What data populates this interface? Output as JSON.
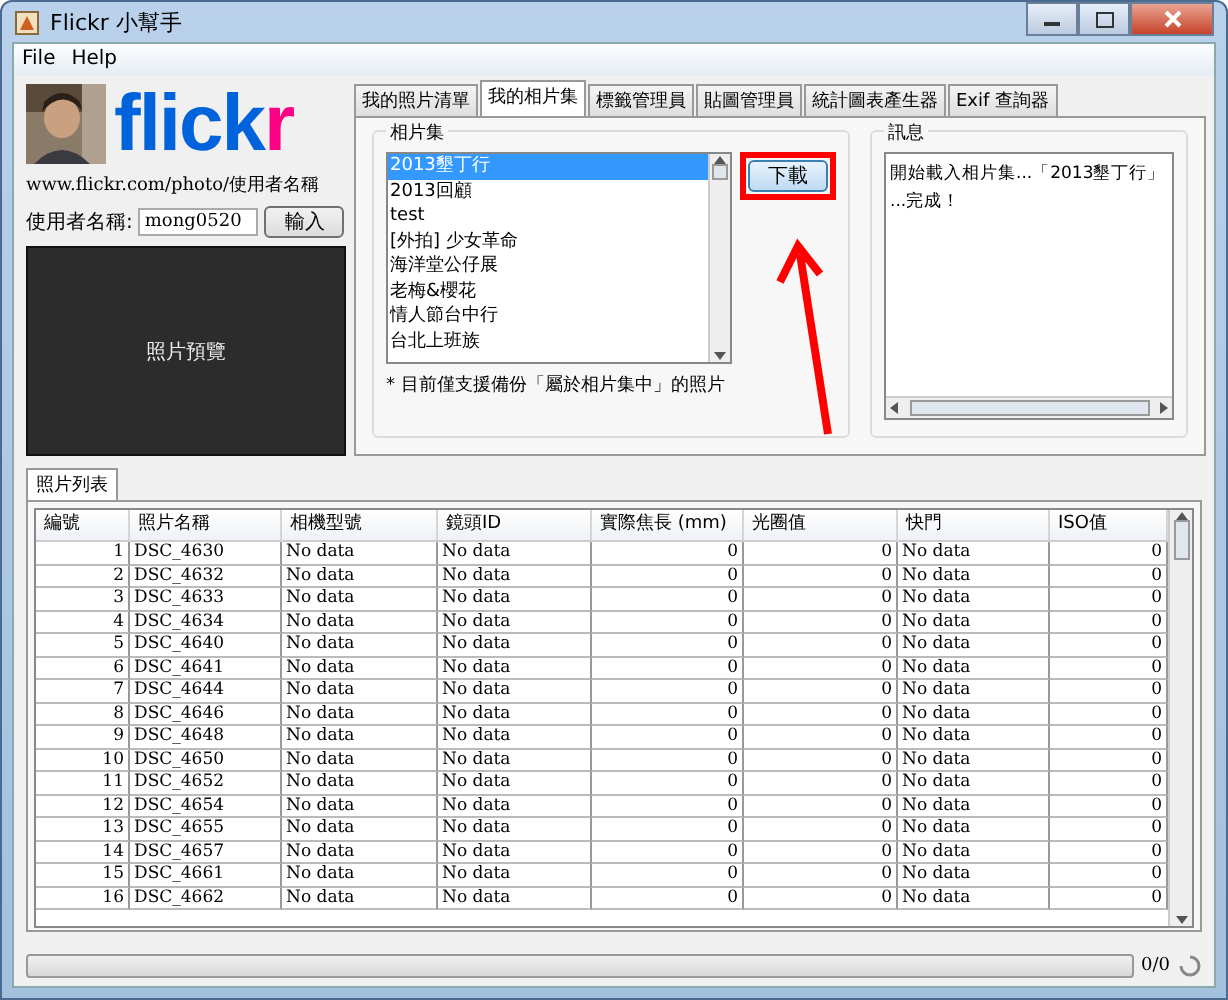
{
  "window": {
    "title": "Flickr 小幫手"
  },
  "menu": [
    "File",
    "Help"
  ],
  "logo": {
    "text": "flickr"
  },
  "profile": {
    "url": "www.flickr.com/photo/使用者名稱",
    "username_label": "使用者名稱:",
    "username": "mong0520",
    "enter_button": "輸入",
    "preview": "照片預覽"
  },
  "tabs": [
    {
      "label": "我的照片清單",
      "selected": false
    },
    {
      "label": "我的相片集",
      "selected": true
    },
    {
      "label": "標籤管理員",
      "selected": false
    },
    {
      "label": "貼圖管理員",
      "selected": false
    },
    {
      "label": "統計圖表產生器",
      "selected": false
    },
    {
      "label": "Exif 查詢器",
      "selected": false
    }
  ],
  "albums": {
    "title": "相片集",
    "items": [
      {
        "label": "2013墾丁行",
        "selected": true
      },
      {
        "label": "2013回顧",
        "selected": false
      },
      {
        "label": "test",
        "selected": false
      },
      {
        "label": "[外拍] 少女革命",
        "selected": false
      },
      {
        "label": "海洋堂公仔展",
        "selected": false
      },
      {
        "label": "老梅&櫻花",
        "selected": false
      },
      {
        "label": "情人節台中行",
        "selected": false
      },
      {
        "label": "台北上班族",
        "selected": false
      }
    ],
    "download_button": "下載",
    "note": "* 目前僅支援備份「屬於相片集中」的照片"
  },
  "messages": {
    "title": "訊息",
    "lines": [
      "開始載入相片集...「2013墾丁行」",
      "...完成！"
    ]
  },
  "photo_tab": {
    "label": "照片列表",
    "selected": true
  },
  "table": {
    "columns": [
      "編號",
      "照片名稱",
      "相機型號",
      "鏡頭ID",
      "實際焦長 (mm)",
      "光圈值",
      "快門",
      "ISO值"
    ],
    "rows": [
      [
        "1",
        "DSC_4630",
        "No data",
        "No data",
        "0",
        "0",
        "No data",
        "0"
      ],
      [
        "2",
        "DSC_4632",
        "No data",
        "No data",
        "0",
        "0",
        "No data",
        "0"
      ],
      [
        "3",
        "DSC_4633",
        "No data",
        "No data",
        "0",
        "0",
        "No data",
        "0"
      ],
      [
        "4",
        "DSC_4634",
        "No data",
        "No data",
        "0",
        "0",
        "No data",
        "0"
      ],
      [
        "5",
        "DSC_4640",
        "No data",
        "No data",
        "0",
        "0",
        "No data",
        "0"
      ],
      [
        "6",
        "DSC_4641",
        "No data",
        "No data",
        "0",
        "0",
        "No data",
        "0"
      ],
      [
        "7",
        "DSC_4644",
        "No data",
        "No data",
        "0",
        "0",
        "No data",
        "0"
      ],
      [
        "8",
        "DSC_4646",
        "No data",
        "No data",
        "0",
        "0",
        "No data",
        "0"
      ],
      [
        "9",
        "DSC_4648",
        "No data",
        "No data",
        "0",
        "0",
        "No data",
        "0"
      ],
      [
        "10",
        "DSC_4650",
        "No data",
        "No data",
        "0",
        "0",
        "No data",
        "0"
      ],
      [
        "11",
        "DSC_4652",
        "No data",
        "No data",
        "0",
        "0",
        "No data",
        "0"
      ],
      [
        "12",
        "DSC_4654",
        "No data",
        "No data",
        "0",
        "0",
        "No data",
        "0"
      ],
      [
        "13",
        "DSC_4655",
        "No data",
        "No data",
        "0",
        "0",
        "No data",
        "0"
      ],
      [
        "14",
        "DSC_4657",
        "No data",
        "No data",
        "0",
        "0",
        "No data",
        "0"
      ],
      [
        "15",
        "DSC_4661",
        "No data",
        "No data",
        "0",
        "0",
        "No data",
        "0"
      ],
      [
        "16",
        "DSC_4662",
        "No data",
        "No data",
        "0",
        "0",
        "No data",
        "0"
      ]
    ]
  },
  "status_bar": {
    "progress": {
      "level": 0
    },
    "count": "0/0"
  }
}
